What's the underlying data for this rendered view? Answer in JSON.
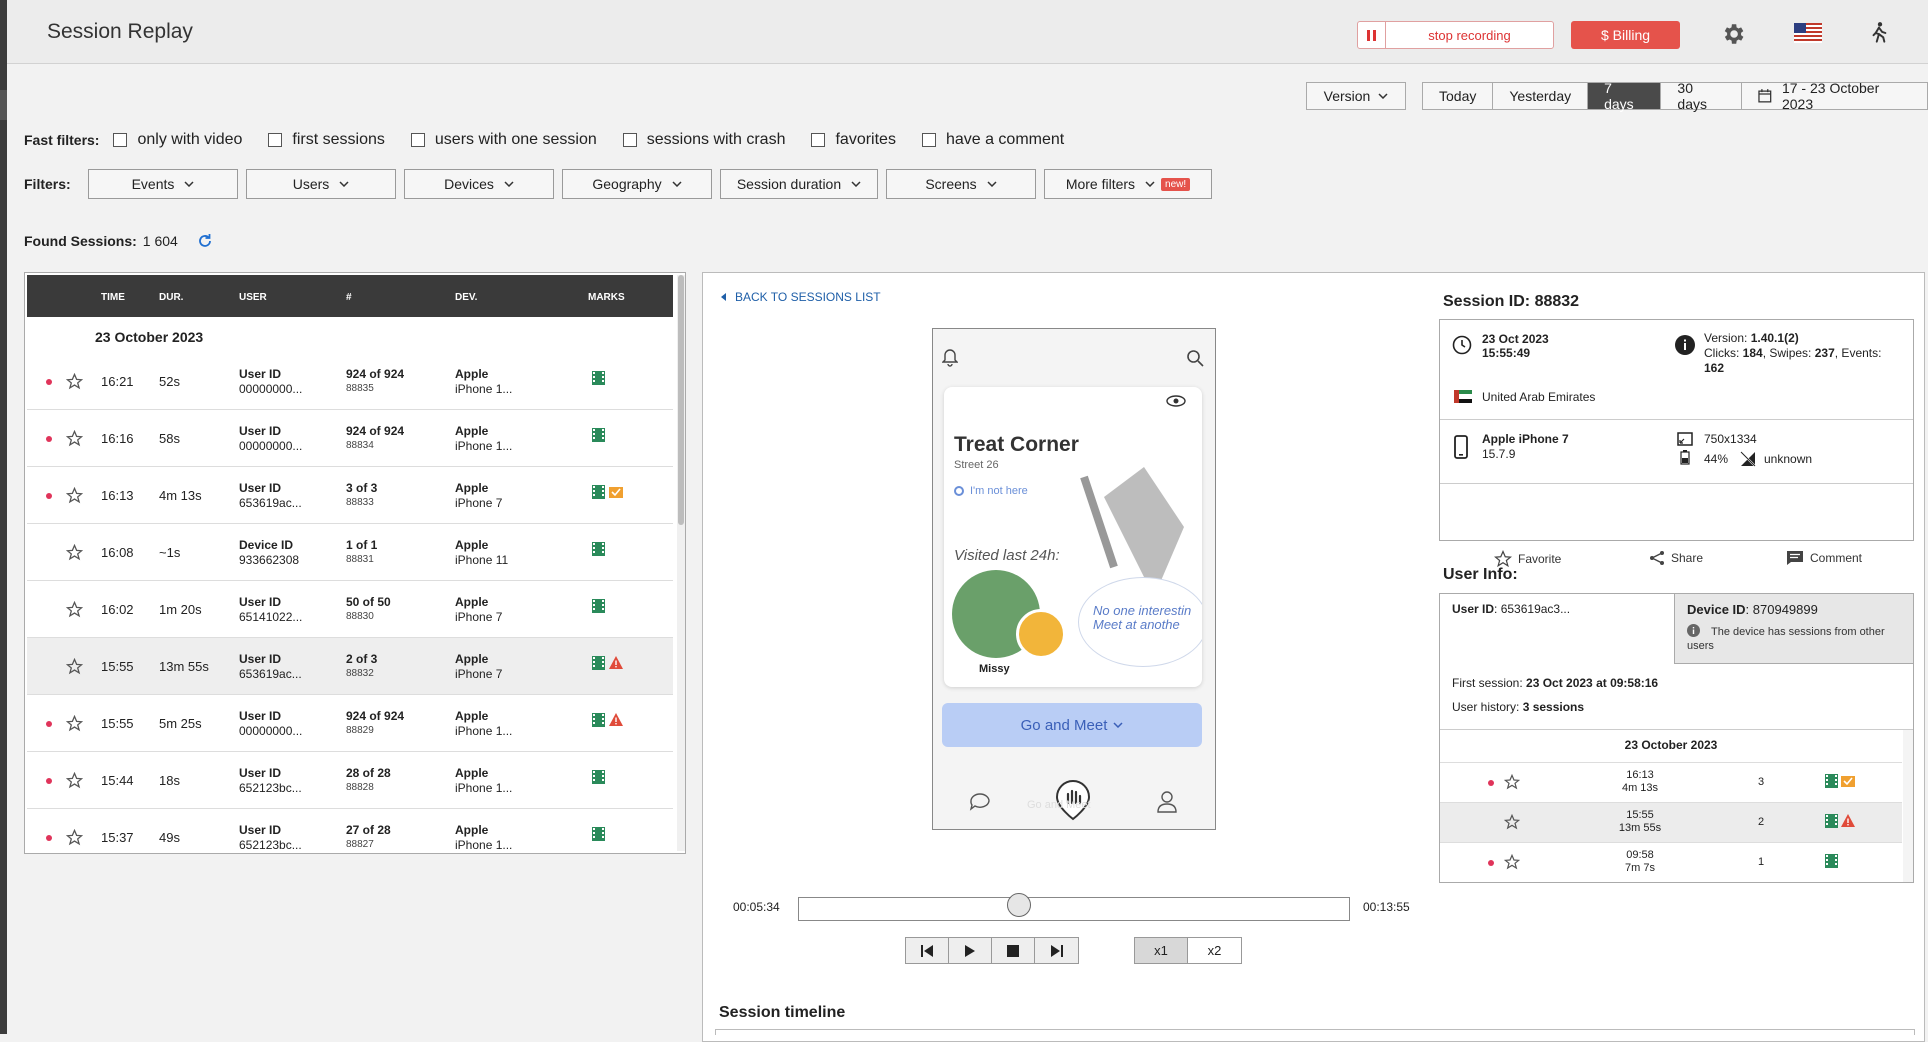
{
  "header": {
    "title": "Session Replay",
    "stop_recording": "stop recording",
    "billing": "$ Billing"
  },
  "range": {
    "version": "Version",
    "options": [
      "Today",
      "Yesterday",
      "7 days",
      "30 days"
    ],
    "active": "7 days",
    "date_range": "17 - 23 October 2023"
  },
  "fast_filters": {
    "label": "Fast filters:",
    "options": [
      "only with video",
      "first sessions",
      "users with one session",
      "sessions with crash",
      "favorites",
      "have a comment"
    ]
  },
  "filters": {
    "label": "Filters:",
    "buttons": [
      "Events",
      "Users",
      "Devices",
      "Geography",
      "Session duration",
      "Screens",
      "More filters"
    ],
    "new_badge": "new!"
  },
  "found": {
    "label": "Found Sessions:",
    "count": "1 604"
  },
  "table": {
    "headers": [
      "TIME",
      "DUR.",
      "USER",
      "#",
      "DEV.",
      "MARKS"
    ],
    "date_group": "23 October 2023",
    "rows": [
      {
        "dot": true,
        "time": "16:21",
        "dur": "52s",
        "user_label": "User ID",
        "user_value": "00000000...",
        "num": "924 of 924",
        "sid": "88835",
        "brand": "Apple",
        "model": "iPhone 1...",
        "marks": [
          "video"
        ]
      },
      {
        "dot": true,
        "time": "16:16",
        "dur": "58s",
        "user_label": "User ID",
        "user_value": "00000000...",
        "num": "924 of 924",
        "sid": "88834",
        "brand": "Apple",
        "model": "iPhone 1...",
        "marks": [
          "video"
        ]
      },
      {
        "dot": true,
        "time": "16:13",
        "dur": "4m 13s",
        "user_label": "User ID",
        "user_value": "653619ac...",
        "num": "3 of 3",
        "sid": "88833",
        "brand": "Apple",
        "model": "iPhone 7",
        "marks": [
          "video",
          "vote"
        ]
      },
      {
        "dot": false,
        "time": "16:08",
        "dur": "~1s",
        "user_label": "Device ID",
        "user_value": "933662308",
        "num": "1 of 1",
        "sid": "88831",
        "brand": "Apple",
        "model": "iPhone 11",
        "marks": [
          "video"
        ]
      },
      {
        "dot": false,
        "time": "16:02",
        "dur": "1m 20s",
        "user_label": "User ID",
        "user_value": "65141022...",
        "num": "50 of 50",
        "sid": "88830",
        "brand": "Apple",
        "model": "iPhone 7",
        "marks": [
          "video"
        ]
      },
      {
        "dot": false,
        "time": "15:55",
        "dur": "13m 55s",
        "user_label": "User ID",
        "user_value": "653619ac...",
        "num": "2 of 3",
        "sid": "88832",
        "brand": "Apple",
        "model": "iPhone 7",
        "marks": [
          "video",
          "crash"
        ],
        "selected": true
      },
      {
        "dot": true,
        "time": "15:55",
        "dur": "5m 25s",
        "user_label": "User ID",
        "user_value": "00000000...",
        "num": "924 of 924",
        "sid": "88829",
        "brand": "Apple",
        "model": "iPhone 1...",
        "marks": [
          "video",
          "crash"
        ]
      },
      {
        "dot": true,
        "time": "15:44",
        "dur": "18s",
        "user_label": "User ID",
        "user_value": "652123bc...",
        "num": "28 of 28",
        "sid": "88828",
        "brand": "Apple",
        "model": "iPhone 1...",
        "marks": [
          "video"
        ]
      },
      {
        "dot": true,
        "time": "15:37",
        "dur": "49s",
        "user_label": "User ID",
        "user_value": "652123bc...",
        "num": "27 of 28",
        "sid": "88827",
        "brand": "Apple",
        "model": "iPhone 1...",
        "marks": [
          "video"
        ]
      }
    ]
  },
  "detail": {
    "back": "BACK TO SESSIONS LIST",
    "time_current": "00:05:34",
    "time_total": "00:13:55",
    "progress": 0.4,
    "speeds": [
      "x1",
      "x2"
    ],
    "active_speed": "x1",
    "timeline_title": "Session timeline"
  },
  "phone": {
    "place_name": "Treat Corner",
    "street": "Street 26",
    "not_here": "I'm not here",
    "visited": "Visited last 24h:",
    "person": "Missy",
    "bubble": "No one interestin Meet at anothe",
    "go_button": "Go and Meet",
    "faded": "Go and Meet"
  },
  "session_info": {
    "title": "Session ID: 88832",
    "date": "23 Oct 2023",
    "time": "15:55:49",
    "version_label": "Version: ",
    "version": "1.40.1(2)",
    "clicks_label": "Clicks: ",
    "clicks": "184",
    "swipes_label": ", Swipes: ",
    "swipes": "237",
    "events_label": ", Events: ",
    "events": "162",
    "country": "United Arab Emirates",
    "device": "Apple iPhone 7",
    "os": "15.7.9",
    "resolution": "750x1334",
    "battery": "44%",
    "network": "unknown",
    "actions": [
      "Favorite",
      "Share",
      "Comment"
    ]
  },
  "user_info": {
    "title": "User Info:",
    "user_id_label": "User ID",
    "user_id": ": 653619ac3...",
    "device_id_label": "Device ID",
    "device_id": ": 870949899",
    "device_note": "The device has sessions from other users",
    "first_session_label": "First session: ",
    "first_session": "23 Oct 2023 at 09:58:16",
    "history_label": "User history: ",
    "history": "3 sessions",
    "history_date": "23 October 2023",
    "history_rows": [
      {
        "dot": true,
        "time": "16:13",
        "dur": "4m 13s",
        "num": "3",
        "marks": [
          "video",
          "vote"
        ]
      },
      {
        "dot": false,
        "time": "15:55",
        "dur": "13m 55s",
        "num": "2",
        "marks": [
          "video",
          "crash"
        ],
        "selected": true
      },
      {
        "dot": true,
        "time": "09:58",
        "dur": "7m 7s",
        "num": "1",
        "marks": [
          "video"
        ]
      }
    ]
  },
  "colors": {
    "accent_red": "#e5534b",
    "dot": "#e0345a",
    "film": "#2a8a5a",
    "link": "#1f5fa8"
  }
}
